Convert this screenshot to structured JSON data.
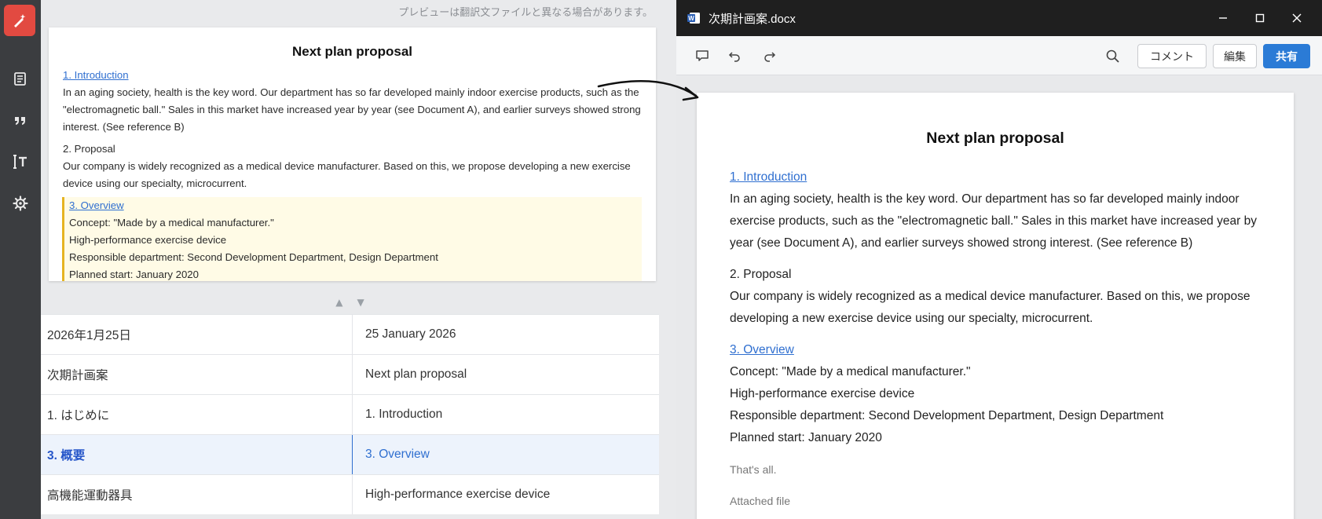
{
  "rail": {
    "items": [
      {
        "name": "document-list-icon"
      },
      {
        "name": "quote-icon"
      },
      {
        "name": "text-size-icon"
      },
      {
        "name": "settings-icon"
      }
    ]
  },
  "translation": {
    "notice": "プレビューは翻訳文ファイルと異なる場合があります。",
    "preview": {
      "title": "Next plan proposal",
      "s1_heading": "1. Introduction",
      "s1_body": "In an aging society, health is the key word. Our department has so far developed mainly indoor exercise products, such as the \"electromagnetic ball.\" Sales in this market have increased year by year (see Document A), and earlier surveys showed strong interest. (See reference B)",
      "s2_heading": "2. Proposal",
      "s2_body": "Our company is widely recognized as a medical device manufacturer. Based on this, we propose developing a new exercise device using our specialty, microcurrent.",
      "s3_heading": "3. Overview",
      "s3_lines": [
        "Concept: \"Made by a medical manufacturer.\"",
        "High-performance exercise device",
        "Responsible department: Second Development Department, Design Department",
        "Planned start: January 2020"
      ]
    },
    "rows": [
      {
        "src": "2026年1月25日",
        "dst": "25 January 2026",
        "active": false
      },
      {
        "src": "次期計画案",
        "dst": "Next plan proposal",
        "active": false
      },
      {
        "src": "1. はじめに",
        "dst": "1. Introduction",
        "active": false
      },
      {
        "src": "3. 概要",
        "dst": "3. Overview",
        "active": true
      },
      {
        "src": "高機能運動器具",
        "dst": "High-performance exercise device",
        "active": false
      }
    ]
  },
  "word": {
    "title": "次期計画案.docx",
    "toolbar": {
      "comment_label": "コメント",
      "edit_label": "編集",
      "share_label": "共有"
    },
    "doc": {
      "title": "Next plan proposal",
      "s1_heading": "1. Introduction",
      "s1_body": "In an aging society, health is the key word. Our department has so far developed mainly indoor exercise products, such as the \"electromagnetic ball.\" Sales in this market have increased year by year (see Document A), and earlier surveys showed strong interest. (See reference B)",
      "s2_heading": "2. Proposal",
      "s2_body": "Our company is widely recognized as a medical device manufacturer. Based on this, we propose developing a new exercise device using our specialty, microcurrent.",
      "s3_heading": "3. Overview",
      "s3_lines": [
        "Concept: \"Made by a medical manufacturer.\"",
        "High-performance exercise device",
        "Responsible department: Second Development Department, Design Department",
        "Planned start: January 2020"
      ],
      "closing": "That's all.",
      "attached": "Attached file"
    }
  },
  "colors": {
    "accent": "#2f6fd0",
    "brand_red": "#e24a41",
    "highlight_border": "#e6b422"
  }
}
